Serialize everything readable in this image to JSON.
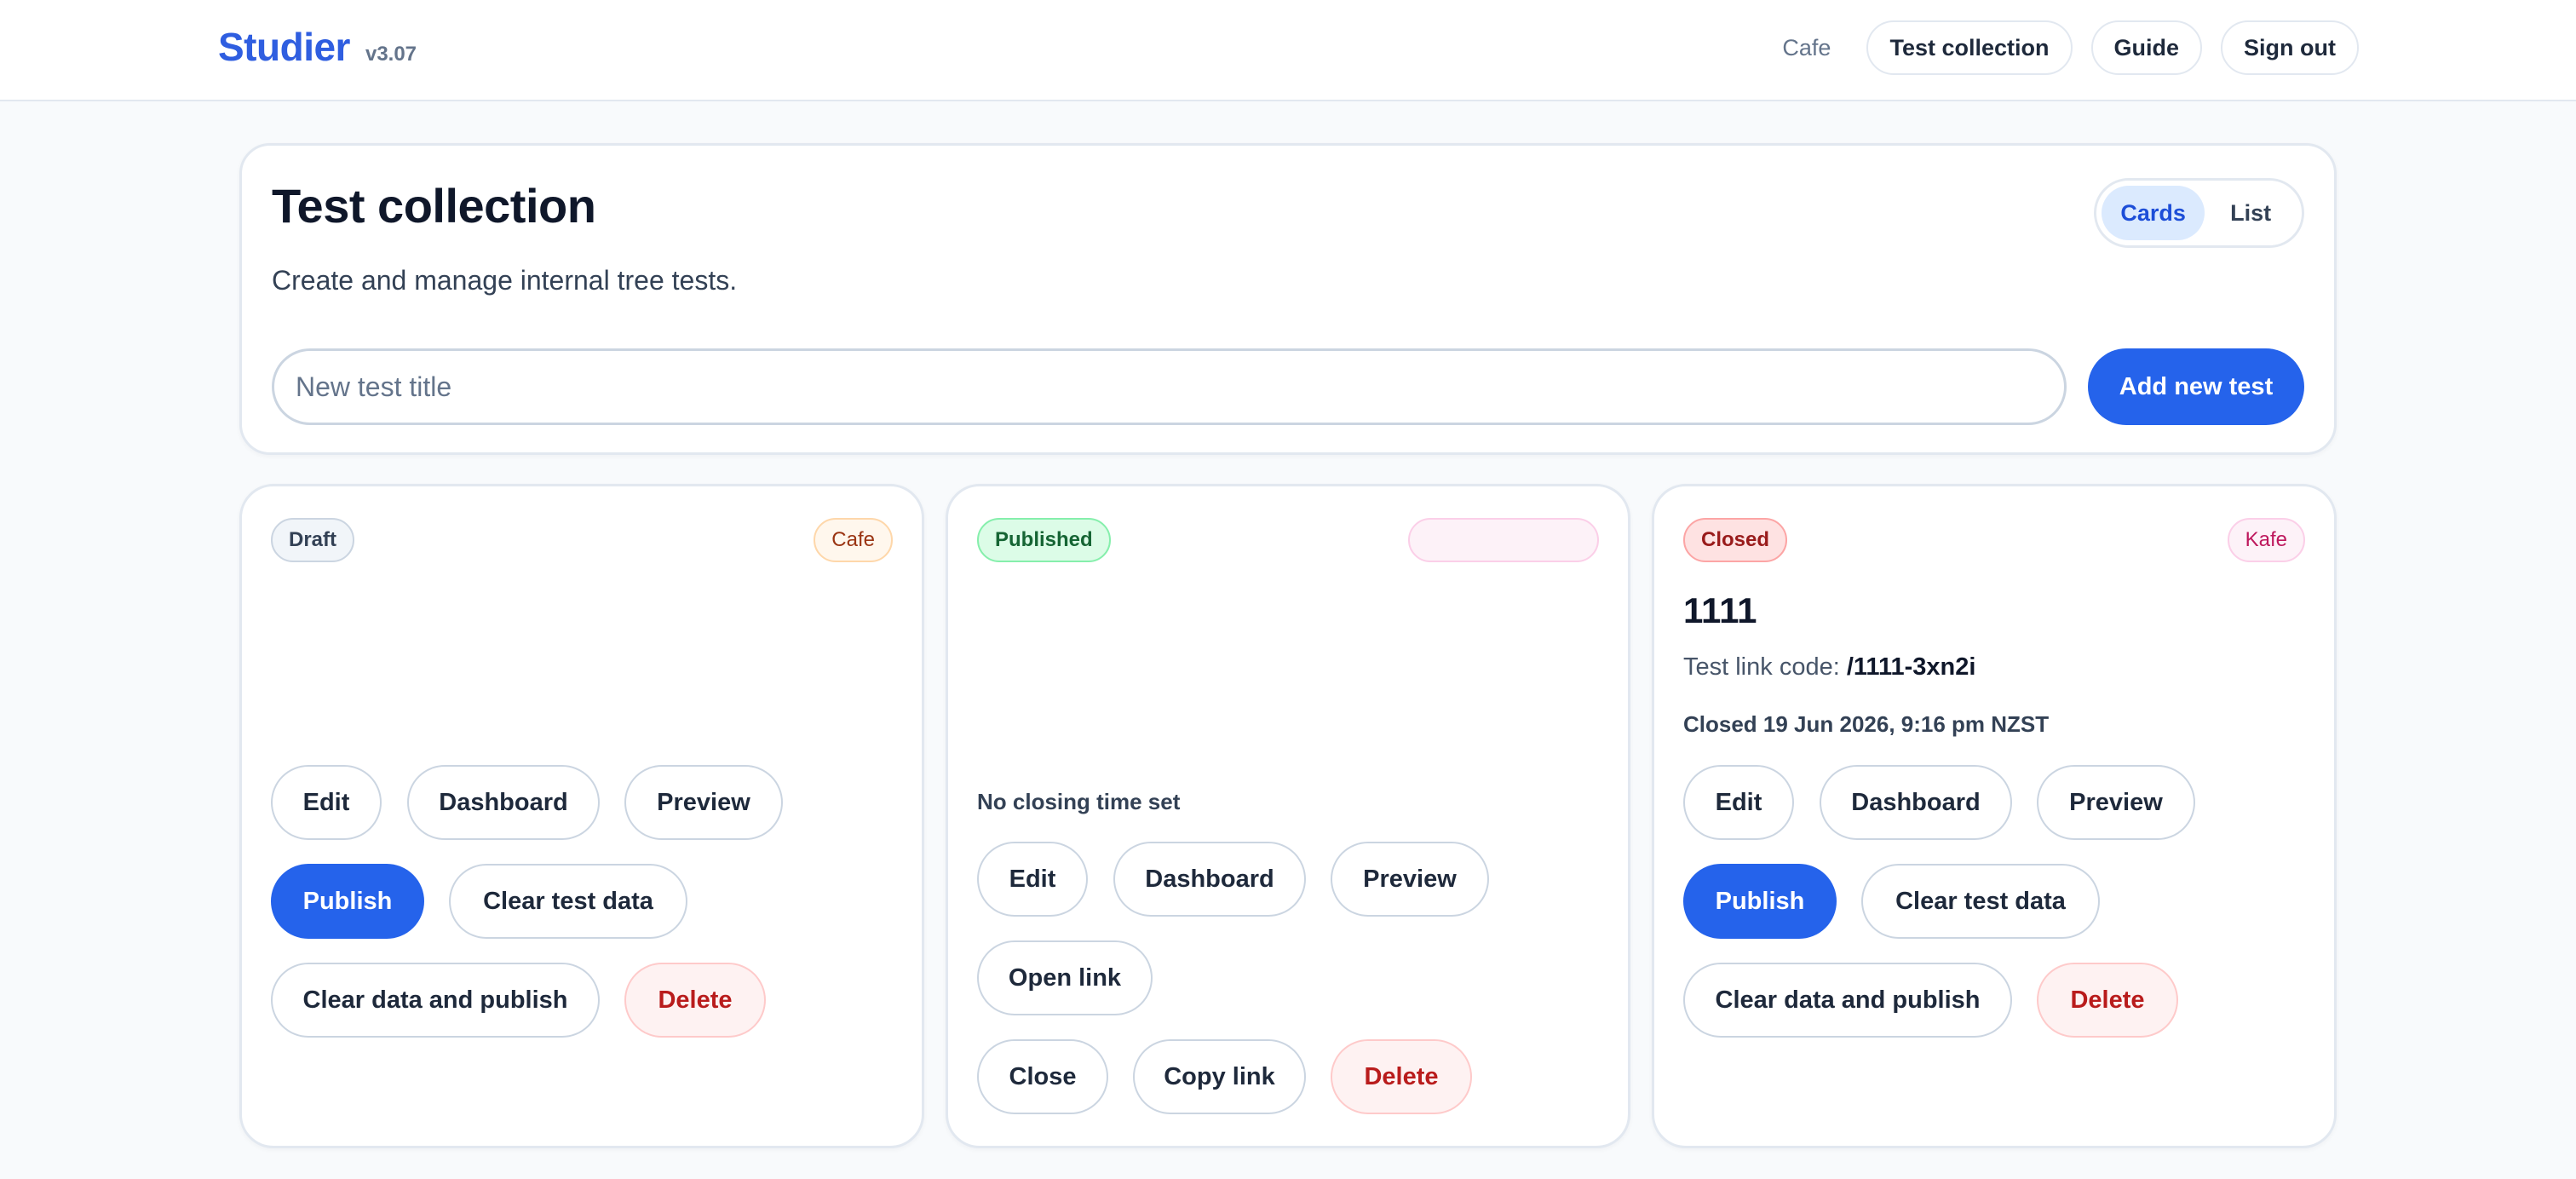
{
  "app": {
    "name": "Studier",
    "version": "v3.07"
  },
  "nav": {
    "org": "Cafe",
    "links": [
      "Test collection",
      "Guide",
      "Sign out"
    ]
  },
  "collection": {
    "title": "Test collection",
    "subtitle": "Create and manage internal tree tests.",
    "view_toggle": {
      "cards": "Cards",
      "list": "List",
      "active": "Cards"
    },
    "new_test": {
      "placeholder": "New test title",
      "value": "",
      "add_label": "Add new test"
    }
  },
  "cards": [
    {
      "status": "Draft",
      "org": "Cafe",
      "buttons": [
        "Edit",
        "Dashboard",
        "Preview",
        "Publish",
        "Clear test data",
        "Clear data and publish",
        "Delete"
      ]
    },
    {
      "status": "Published",
      "org": "",
      "note": "No closing time set",
      "buttons": [
        "Edit",
        "Dashboard",
        "Preview",
        "Open link",
        "Close",
        "Copy link",
        "Delete"
      ]
    },
    {
      "status": "Closed",
      "org": "Kafe",
      "title": "1111",
      "code_label": "Test link code:",
      "code": "/1111-3xn2i",
      "closed_at": "Closed 19 Jun 2026, 9:16 pm NZST",
      "buttons": [
        "Edit",
        "Dashboard",
        "Preview",
        "Publish",
        "Clear test data",
        "Clear data and publish",
        "Delete"
      ]
    }
  ],
  "colors": {
    "brand": "#2f5ee0",
    "primary": "#2563eb",
    "danger": "#b91c1c",
    "background": "#f8fafc"
  }
}
